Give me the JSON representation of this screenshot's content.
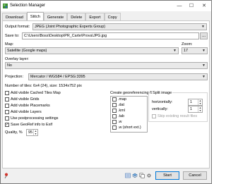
{
  "window": {
    "title": "Selection Manager",
    "controls": {
      "minimize": "—",
      "maximize": "☐",
      "close": "✕"
    }
  },
  "tabs": [
    {
      "label": "Download",
      "active": false
    },
    {
      "label": "Stitch",
      "active": true
    },
    {
      "label": "Generate",
      "active": false
    },
    {
      "label": "Delete",
      "active": false
    },
    {
      "label": "Export",
      "active": false
    },
    {
      "label": "Copy",
      "active": false
    }
  ],
  "stitch": {
    "output_format_label": "Output format:",
    "output_format_value": "JPEG (Joint Photographic Experts Group)",
    "save_to_label": "Save to:",
    "save_to_value": "C:\\Users\\Boss\\Desktop\\PR_Carte\\Prova\\JPG.jpg",
    "browse_label": "...",
    "map_label": "Map:",
    "map_value": "Satellite (Google maps)",
    "zoom_label": "Zoom:",
    "zoom_value": "17",
    "overlay_label": "Overlay layer:",
    "overlay_value": "No",
    "projection_label": "Projection:",
    "projection_value": "Mercator / WGS84 / EPSG:3395",
    "tiles_info": "Number of tiles: 6x4 (24), size: 1534x752 pix",
    "options": [
      {
        "label": "Add visible Cached Tiles Map",
        "checked": false,
        "enabled": true
      },
      {
        "label": "Add visible Grids",
        "checked": false,
        "enabled": true
      },
      {
        "label": "Add visible Placemarks",
        "checked": false,
        "enabled": true
      },
      {
        "label": "Add visible Layers",
        "checked": false,
        "enabled": true
      },
      {
        "label": "Use postprocessing settings",
        "checked": false,
        "enabled": true
      },
      {
        "label": "Save GeoRef info to Exif",
        "checked": true,
        "enabled": true
      }
    ],
    "quality_label": "Quality, %",
    "quality_value": "95",
    "georef": {
      "title": "Create georeferencing file:",
      "items": [
        {
          "label": ".map",
          "checked": false
        },
        {
          "label": ".dat",
          "checked": false
        },
        {
          "label": ".kml",
          "checked": false
        },
        {
          "label": ".tab",
          "checked": false
        },
        {
          "label": ".w",
          "checked": false
        },
        {
          "label": ".w (short ext.)",
          "checked": false
        }
      ]
    },
    "split": {
      "title": "Split image",
      "horizontally_label": "horizontally:",
      "horizontally_value": "1",
      "vertically_label": "vertically:",
      "vertically_value": "1",
      "skip_label": "Skip existing result files",
      "skip_checked": false,
      "skip_enabled": false
    }
  },
  "footer": {
    "start_label": "Start",
    "cancel_label": "Cancel",
    "icons": [
      "pin-icon",
      "queue-icon",
      "layers-icon",
      "copy-icon",
      "settings-icon"
    ]
  }
}
